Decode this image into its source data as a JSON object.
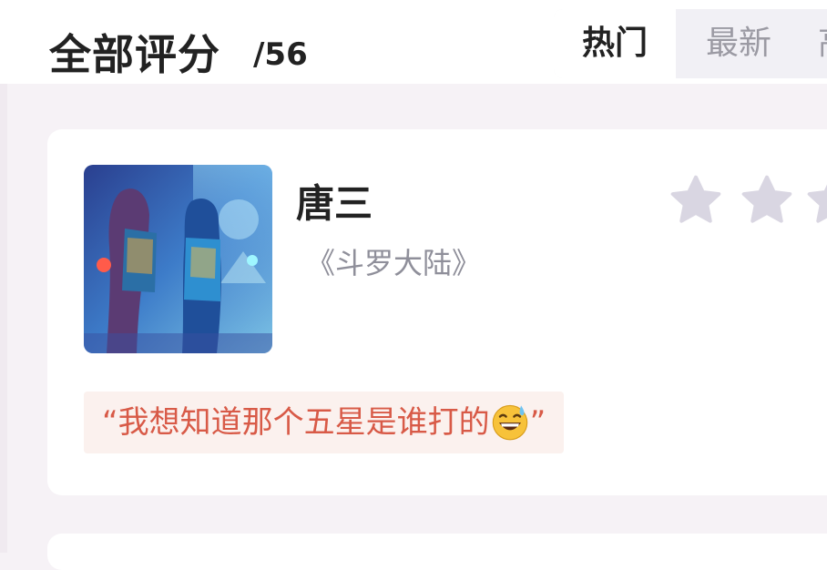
{
  "header": {
    "title": "全部评分",
    "count": "/56"
  },
  "tabs": [
    {
      "label": "热门",
      "active": true
    },
    {
      "label": "最新",
      "active": false
    },
    {
      "label": "高",
      "active": false
    }
  ],
  "review": {
    "character": "唐三",
    "work": "《斗罗大陆》",
    "stars_visible": 3,
    "star_color": "#d9d6e2",
    "quote_open": "“",
    "quote_text": "我想知道那个五星是谁打的",
    "emoji": "grinning-sweat-emoji",
    "quote_close": "”",
    "quote_color": "#d85a47"
  }
}
